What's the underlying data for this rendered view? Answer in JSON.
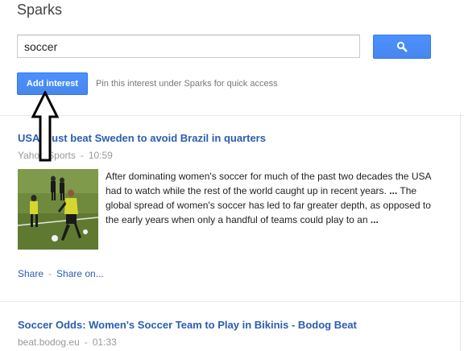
{
  "header": {
    "title": "Sparks"
  },
  "search": {
    "value": "soccer",
    "button_icon": "search-icon"
  },
  "interest": {
    "add_label": "Add interest",
    "hint": "Pin this interest under Sparks for quick access"
  },
  "articles": [
    {
      "title": "USA must beat Sweden to avoid Brazil in quarters",
      "source": "Yahoo Sports",
      "time": "10:59",
      "ellipsis": "...",
      "snippet_part1": "After dominating women's soccer for much of the past two decades the USA had to watch while the rest of the world caught up in recent years.",
      "snippet_part2": "The global spread of women's soccer has led to far greater depth, as opposed to the early years when only a handful of teams could play to an",
      "share_label": "Share",
      "share_on_label": "Share on..."
    },
    {
      "title": "Soccer Odds: Women's Soccer Team to Play in Bikinis - Bodog Beat",
      "source": "beat.bodog.eu",
      "time": "01:33"
    }
  ],
  "separator": "-",
  "colors": {
    "link": "#2a5db0",
    "button_blue": "#4d90fe",
    "meta_gray": "#999999"
  }
}
